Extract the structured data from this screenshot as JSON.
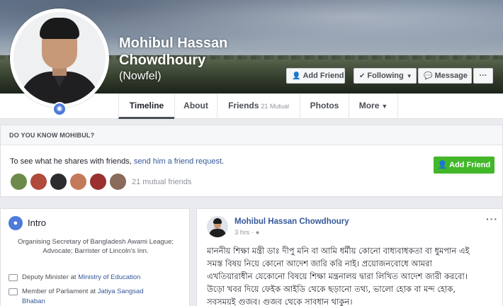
{
  "profile": {
    "name_line1": "Mohibul Hassan",
    "name_line2": "Chowdhoury",
    "alt_name": "(Nowfel)",
    "verified_icon": "shield-icon"
  },
  "cover_actions": {
    "add_friend": "Add Friend",
    "following": "Following",
    "message": "Message",
    "more": "···"
  },
  "tabs": {
    "timeline": "Timeline",
    "about": "About",
    "friends": "Friends",
    "friends_sub": "21 Mutual",
    "photos": "Photos",
    "more": "More"
  },
  "know": {
    "heading": "DO YOU KNOW MOHIBUL?",
    "text_before": "To see what he shares with friends, ",
    "link": "send him a friend request",
    "text_after": ".",
    "add_friend": "Add Friend",
    "mutual": "21 mutual friends",
    "face_colors": [
      "#6e8a4a",
      "#b04a3a",
      "#2d2d30",
      "#c47a5a",
      "#9a3030",
      "#8a6a5a",
      "#c98a7a"
    ]
  },
  "intro": {
    "title": "Intro",
    "bio": "Organising Secretary of Bangladesh Awami League; Advocate; Barrister of Lincoln's Inn.",
    "job1_prefix": "Deputy Minister at ",
    "job1_link": "Ministry of Education",
    "job2_prefix": "Member of Parliament at ",
    "job2_link": "Jatiya Sangsad",
    "job2_link2": "Bhaban"
  },
  "post": {
    "author": "Mohibul Hassan Chowdhoury",
    "time": "3 hrs ·",
    "more": "···",
    "body": "মাননীয় শিক্ষা মন্ত্রী ডাঃ দীপু মনি বা আমি ধর্মীয় কোনো বাধ্যবাধকতা বা ধুমপান এই\nসমস্ত বিষয় নিয়ে কোনো আদেশ জারি করি নাই। প্রয়োজনবোধে আমরা\nএখতিয়ারাধীন যেকোনো বিষয়ে শিক্ষা মন্ত্রনালয় দ্বারা লিখিত আদেশ জারী করবো।\nউড়ো খবর দিয়ে ফেইক আইডি থেকে ছড়ানো তথ্য, ভালো হোক বা মন্দ হোক,\nসবসময়ই গুজব। গুজব থেকে সাবধান থাকুন।"
  },
  "colors": {
    "link": "#365899",
    "green": "#42b72a",
    "background": "#e9ebee"
  }
}
